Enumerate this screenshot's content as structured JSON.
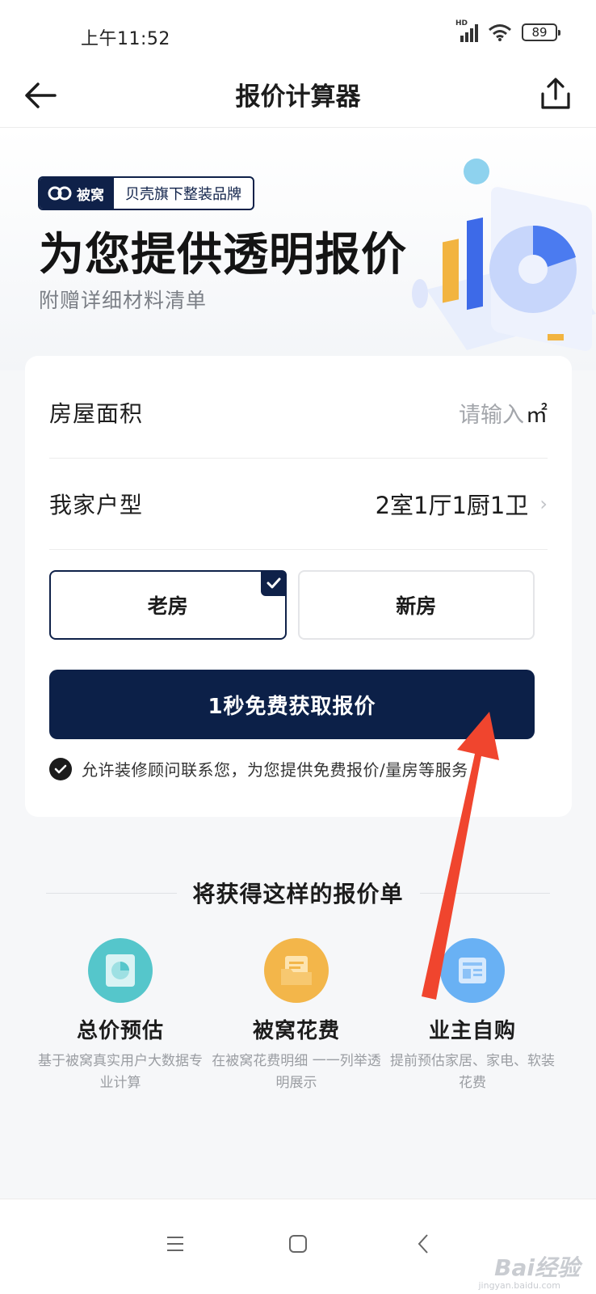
{
  "status": {
    "time": "上午11:52",
    "network": "HD",
    "battery": "89"
  },
  "nav": {
    "title": "报价计算器",
    "back_icon": "arrow-left-icon",
    "share_icon": "share-icon"
  },
  "hero": {
    "brand_logo_text": "被窝",
    "brand_tagline": "贝壳旗下整装品牌",
    "title": "为您提供透明报价",
    "subtitle": "附赠详细材料清单"
  },
  "form": {
    "area_label": "房屋面积",
    "area_placeholder": "请输入",
    "area_unit": "㎡",
    "layout_label": "我家户型",
    "layout_value": "2室1厅1厨1卫",
    "option_old": "老房",
    "option_new": "新房",
    "selected_option": "老房",
    "cta_label": "1秒免费获取报价",
    "agreement_checked": true,
    "agreement_text": "允许装修顾问联系您，为您提供免费报价/量房等服务"
  },
  "section": {
    "title": "将获得这样的报价单"
  },
  "features": [
    {
      "name": "总价预估",
      "desc": "基于被窝真实用户大数据专业计算",
      "color": "#4fc3c7"
    },
    {
      "name": "被窝花费",
      "desc": "在被窝花费明细 一一列举透明展示",
      "color": "#f2b440"
    },
    {
      "name": "业主自购",
      "desc": "提前预估家居、家电、软装花费",
      "color": "#5aa6f2"
    }
  ],
  "colors": {
    "primary": "#0c2048",
    "annotation_arrow": "#f0452e"
  },
  "watermark": {
    "text": "Bai经验",
    "sub": "jingyan.baidu.com"
  }
}
